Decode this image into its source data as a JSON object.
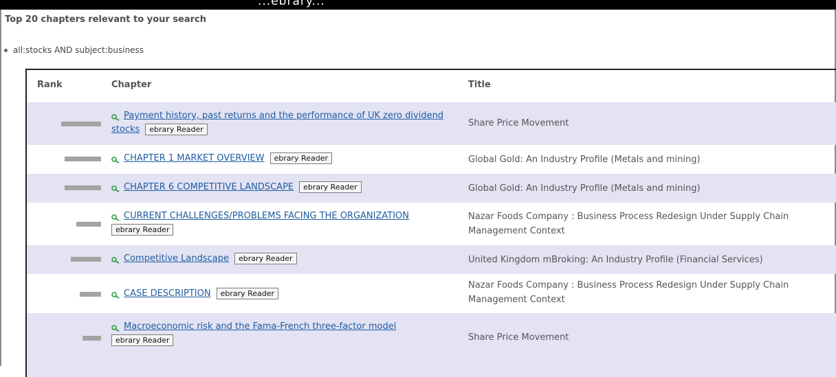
{
  "topStrip": {
    "text": "...ebrary..."
  },
  "heading": "Top 20 chapters relevant to your search",
  "query": "all:stocks AND subject:business",
  "columns": {
    "rank": "Rank",
    "chapter": "Chapter",
    "title": "Title"
  },
  "reader_label": "ebrary Reader",
  "rows": [
    {
      "chapter": "Payment history, past returns and the performance of UK zero dividend stocks",
      "title": "Share Price Movement",
      "rank_score": 0.97
    },
    {
      "chapter": "CHAPTER 1 MARKET OVERVIEW",
      "title": "Global Gold: An Industry Profile (Metals and mining)",
      "rank_score": 0.89
    },
    {
      "chapter": "CHAPTER 6 COMPETITIVE LANDSCAPE",
      "title": "Global Gold: An Industry Profile (Metals and mining)",
      "rank_score": 0.89
    },
    {
      "chapter": "CURRENT CHALLENGES/PROBLEMS FACING THE ORGANIZATION",
      "title": "Nazar Foods Company : Business Process Redesign Under Supply Chain Management Context",
      "rank_score": 0.6
    },
    {
      "chapter": "Competitive Landscape",
      "title": "United Kingdom mBroking: An Industry Profile (Financial Services)",
      "rank_score": 0.73
    },
    {
      "chapter": "CASE DESCRIPTION",
      "title": "Nazar Foods Company : Business Process Redesign Under Supply Chain Management Context",
      "rank_score": 0.52
    },
    {
      "chapter": "Macroeconomic risk and the Fama-French three-factor model",
      "title": "Share Price Movement",
      "rank_score": 0.45
    }
  ]
}
